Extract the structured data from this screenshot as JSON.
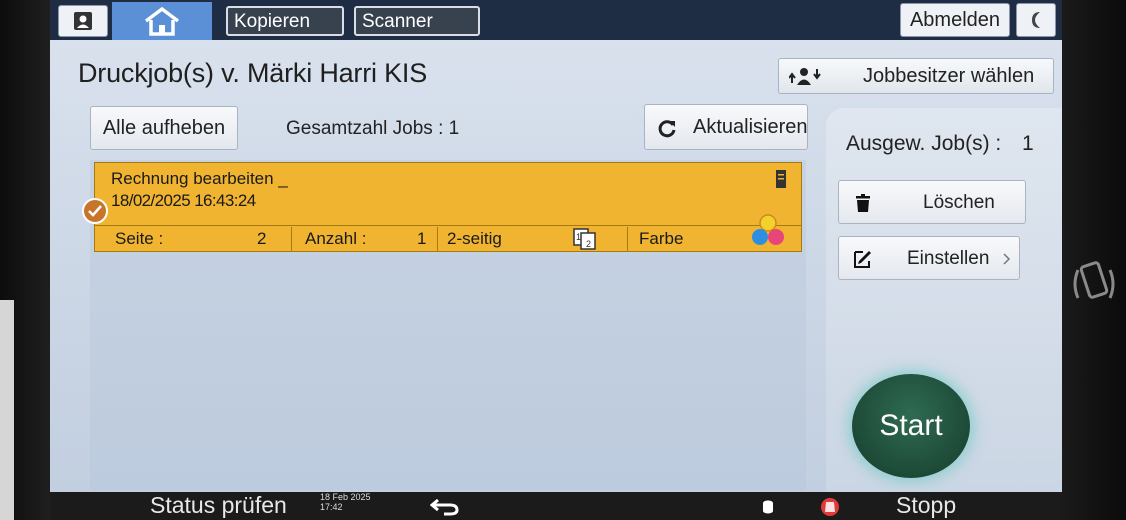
{
  "topbar": {
    "apps": [
      "Kopieren",
      "Scanner"
    ],
    "logout_label": "Abmelden"
  },
  "page": {
    "title": "Druckjob(s) v. Märki Harri KIS",
    "owner_button_label": "Jobbesitzer wählen",
    "release_all_label": "Alle aufheben",
    "total_jobs_label": "Gesamtzahl Jobs : 1",
    "refresh_label": "Aktualisieren"
  },
  "job": {
    "name": "Rechnung bearbeiten _",
    "datetime": "18/02/2025 16:43:24",
    "pages_label": "Seite :",
    "pages_value": "2",
    "copies_label": "Anzahl :",
    "copies_value": "1",
    "duplex": "2-seitig",
    "color_mode": "Farbe",
    "selected": true
  },
  "panel": {
    "selected_label": "Ausgew. Job(s) :",
    "selected_count": "1",
    "delete_label": "Löschen",
    "settings_label": "Einstellen",
    "start_label": "Start"
  },
  "bottombar": {
    "status_label": "Status prüfen",
    "date": "18 Feb 2025",
    "time": "17:42",
    "stop_label": "Stopp"
  },
  "icons": [
    "user-icon",
    "home-icon",
    "moon-icon",
    "owner-switch-icon",
    "refresh-icon",
    "document-icon",
    "duplex-icon",
    "color-icon",
    "checkmark-icon",
    "trash-icon",
    "edit-icon",
    "chevron-right-icon",
    "back-arrow-icon",
    "storage-icon",
    "stop-icon",
    "nfc-phone-icon"
  ],
  "colors": {
    "job_highlight": "#f0b431",
    "topbar": "#1e2c44",
    "home_tab": "#5b8fd6",
    "start_button": "#1f5a41"
  }
}
